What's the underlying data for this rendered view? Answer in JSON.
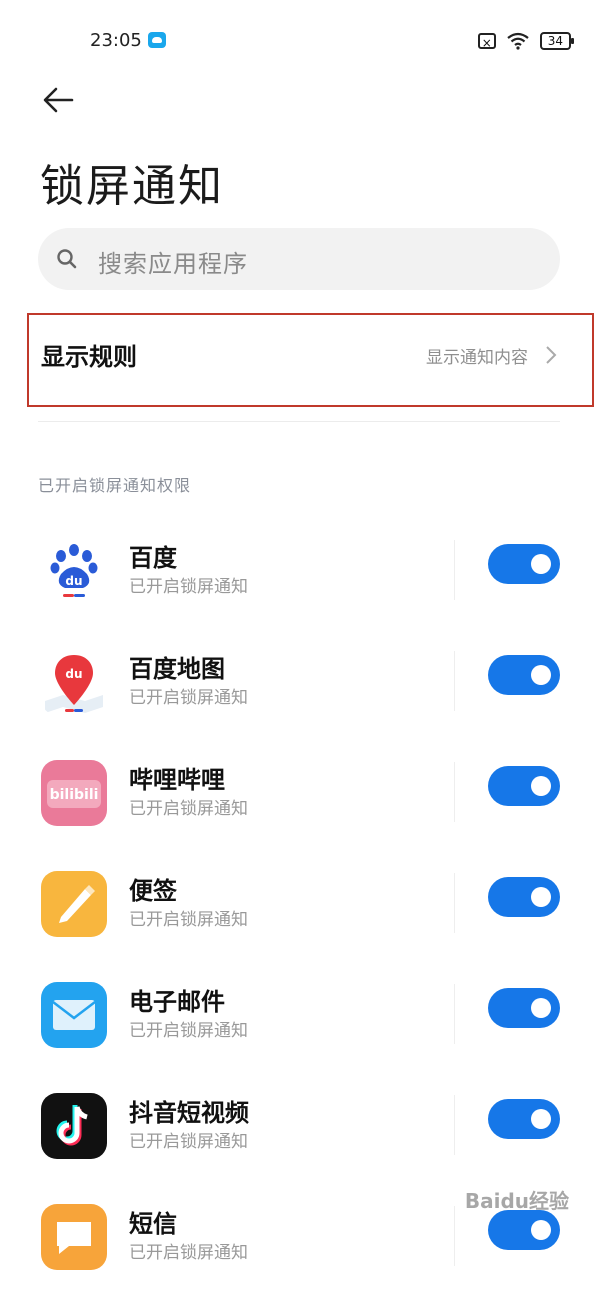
{
  "status_bar": {
    "time": "23:05",
    "battery": "34"
  },
  "header": {
    "title": "锁屏通知"
  },
  "search": {
    "placeholder": "搜索应用程序"
  },
  "rule": {
    "title": "显示规则",
    "value": "显示通知内容"
  },
  "section": {
    "header": "已开启锁屏通知权限"
  },
  "apps": [
    {
      "name": "百度",
      "status": "已开启锁屏通知",
      "icon": "baidu-icon",
      "enabled": true
    },
    {
      "name": "百度地图",
      "status": "已开启锁屏通知",
      "icon": "baidu-map-icon",
      "enabled": true
    },
    {
      "name": "哔哩哔哩",
      "status": "已开启锁屏通知",
      "icon": "bilibili-icon",
      "enabled": true
    },
    {
      "name": "便签",
      "status": "已开启锁屏通知",
      "icon": "notes-icon",
      "enabled": true
    },
    {
      "name": "电子邮件",
      "status": "已开启锁屏通知",
      "icon": "mail-icon",
      "enabled": true
    },
    {
      "name": "抖音短视频",
      "status": "已开启锁屏通知",
      "icon": "douyin-icon",
      "enabled": true
    },
    {
      "name": "短信",
      "status": "已开启锁屏通知",
      "icon": "sms-icon",
      "enabled": true
    }
  ],
  "icon_texts": {
    "baidu": "du",
    "bilibili": "bilibili"
  },
  "watermark": "Baidu经验",
  "colors": {
    "toggle_on": "#1677e8",
    "highlight_border": "#c0392b"
  }
}
